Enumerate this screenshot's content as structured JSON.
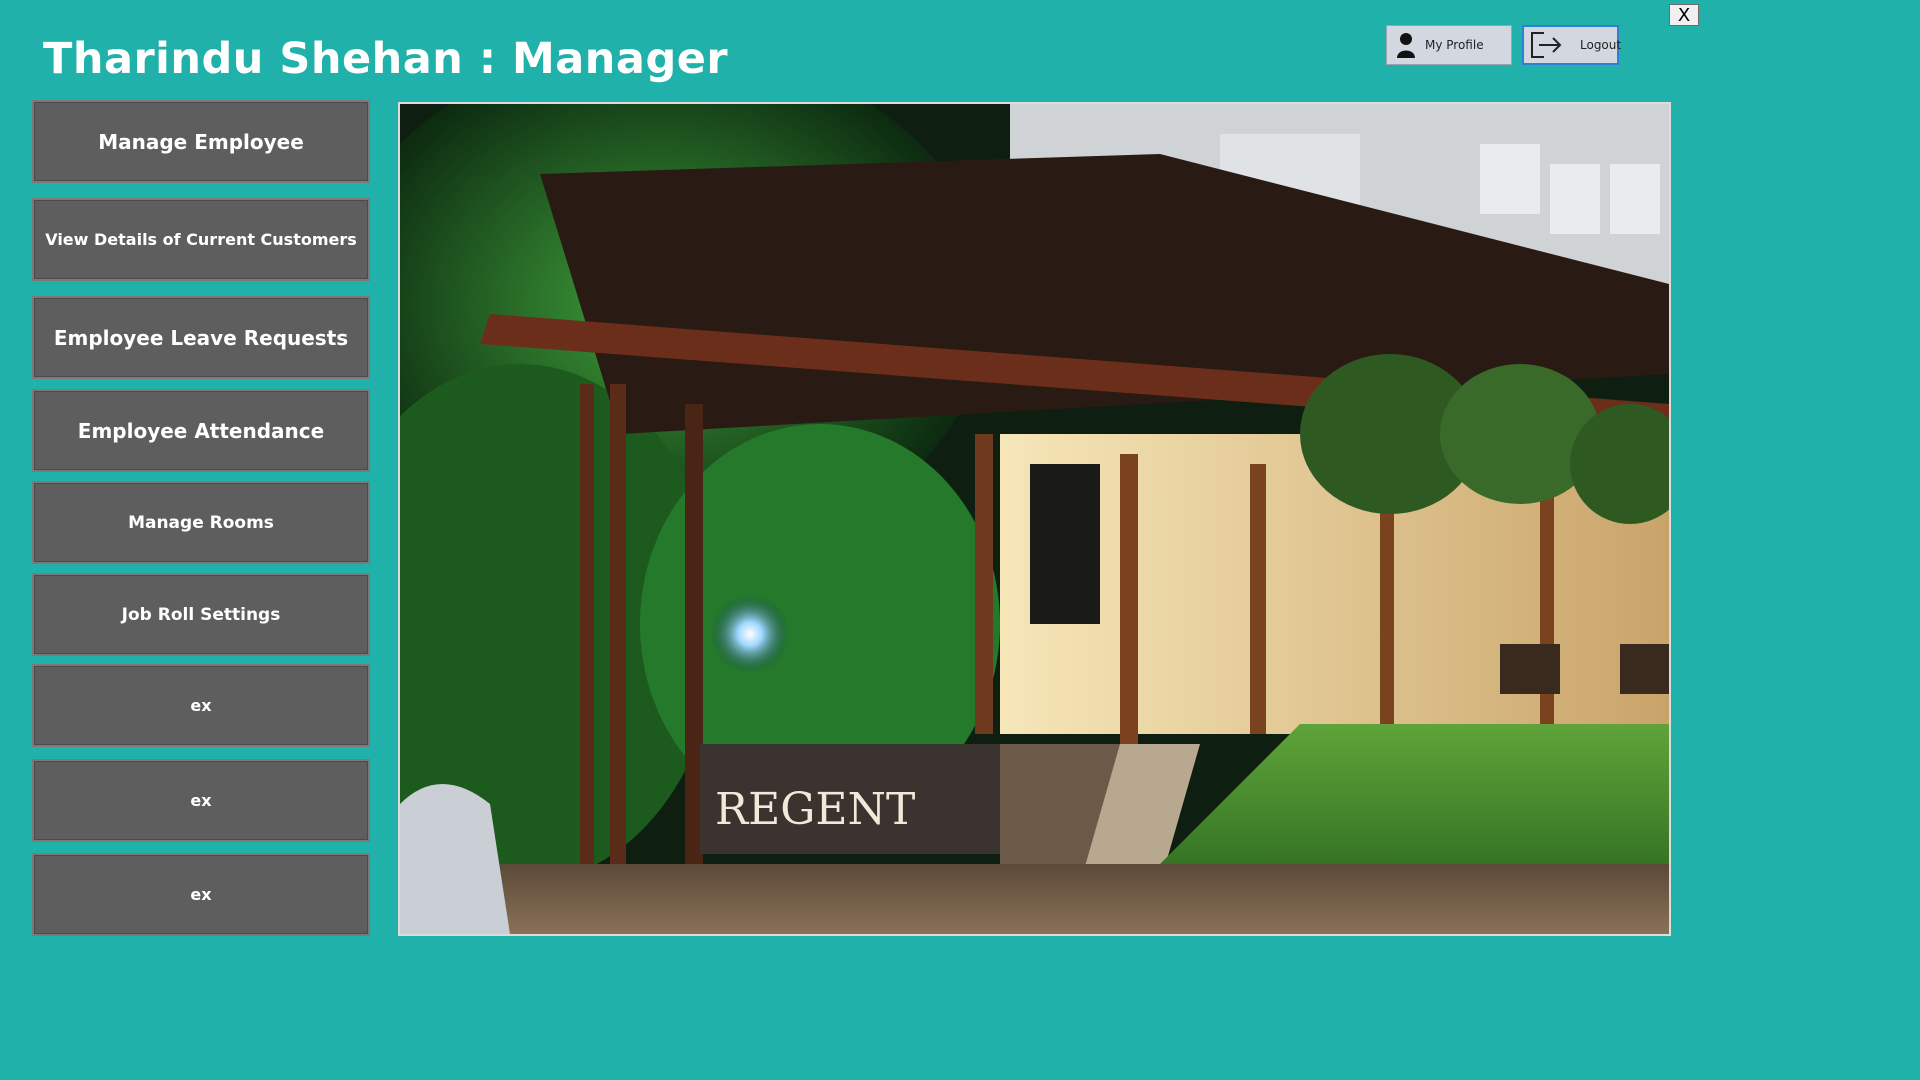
{
  "window": {
    "title": "Tharindu Shehan : Manager",
    "close_label": "X"
  },
  "header": {
    "profile_label": "My Profile",
    "logout_label": "Logout"
  },
  "menu": {
    "items": [
      {
        "label": "Manage Employee"
      },
      {
        "label": "View Details of Current Customers"
      },
      {
        "label": "Employee Leave Requests"
      },
      {
        "label": "Employee Attendance"
      },
      {
        "label": "Manage Rooms"
      },
      {
        "label": "Job Roll Settings"
      },
      {
        "label": "ex"
      },
      {
        "label": "ex"
      },
      {
        "label": "ex"
      }
    ]
  },
  "photo": {
    "sign_text": "REGENT"
  },
  "colors": {
    "background": "#20b2aa",
    "menu_button": "#5e5e5e",
    "title_text": "#ffffff",
    "logout_border": "#2f7fd8"
  },
  "icons": {
    "profile": "user-icon",
    "logout": "logout-arrow-icon",
    "close": "close-icon"
  }
}
